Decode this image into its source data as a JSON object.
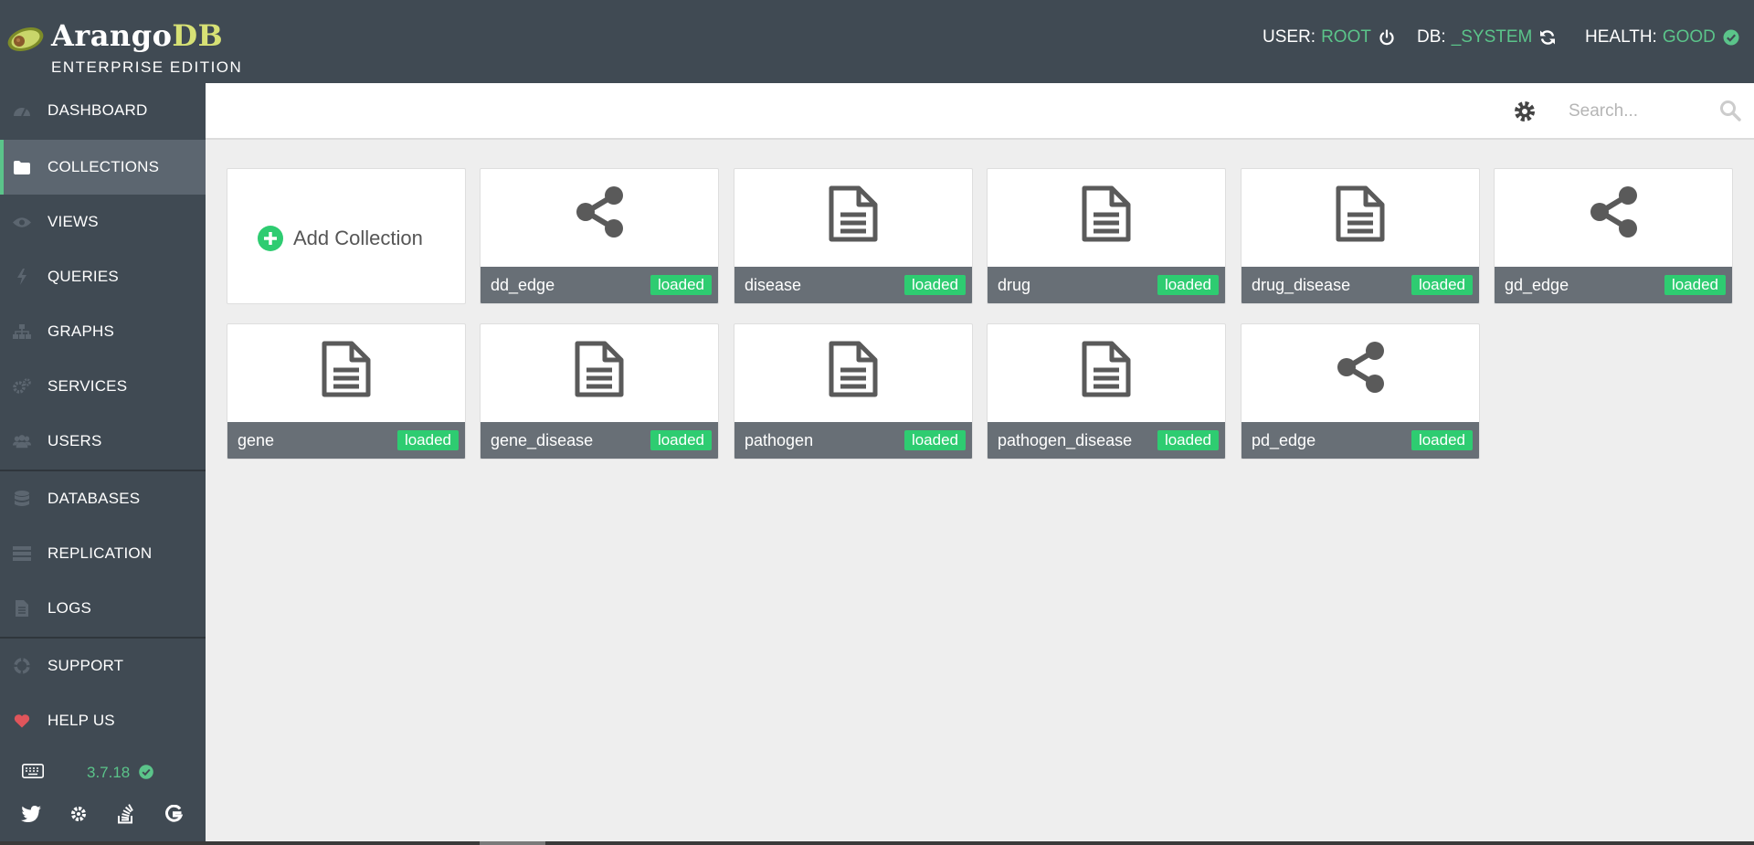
{
  "brand": {
    "name_main": "Arango",
    "name_accent": "DB",
    "edition": "ENTERPRISE EDITION",
    "accent_color": "#d7e175"
  },
  "status": {
    "user_label": "USER:",
    "user_value": "ROOT",
    "db_label": "DB:",
    "db_value": "_SYSTEM",
    "health_label": "HEALTH:",
    "health_value": "GOOD",
    "value_color": "#5bc48a"
  },
  "nav": {
    "items": [
      {
        "label": "DASHBOARD",
        "icon": "dashboard-icon"
      },
      {
        "label": "COLLECTIONS",
        "icon": "folder-icon",
        "active": true
      },
      {
        "label": "VIEWS",
        "icon": "eye-icon"
      },
      {
        "label": "QUERIES",
        "icon": "bolt-icon"
      },
      {
        "label": "GRAPHS",
        "icon": "sitemap-icon"
      },
      {
        "label": "SERVICES",
        "icon": "cogs-icon"
      },
      {
        "label": "USERS",
        "icon": "users-icon"
      },
      {
        "label": "DATABASES",
        "icon": "database-icon"
      },
      {
        "label": "REPLICATION",
        "icon": "server-icon"
      },
      {
        "label": "LOGS",
        "icon": "file-text-icon"
      },
      {
        "label": "SUPPORT",
        "icon": "life-ring-icon"
      },
      {
        "label": "HELP US",
        "icon": "heart-icon"
      }
    ],
    "version": "3.7.18"
  },
  "search": {
    "placeholder": "Search..."
  },
  "collections": {
    "add_label": "Add Collection",
    "items": [
      {
        "name": "dd_edge",
        "status": "loaded",
        "kind": "edge"
      },
      {
        "name": "disease",
        "status": "loaded",
        "kind": "document"
      },
      {
        "name": "drug",
        "status": "loaded",
        "kind": "document"
      },
      {
        "name": "drug_disease",
        "status": "loaded",
        "kind": "document"
      },
      {
        "name": "gd_edge",
        "status": "loaded",
        "kind": "edge"
      },
      {
        "name": "gene",
        "status": "loaded",
        "kind": "document"
      },
      {
        "name": "gene_disease",
        "status": "loaded",
        "kind": "document"
      },
      {
        "name": "pathogen",
        "status": "loaded",
        "kind": "document"
      },
      {
        "name": "pathogen_disease",
        "status": "loaded",
        "kind": "document"
      },
      {
        "name": "pd_edge",
        "status": "loaded",
        "kind": "edge"
      }
    ],
    "badge_color": "#2ecc71"
  }
}
